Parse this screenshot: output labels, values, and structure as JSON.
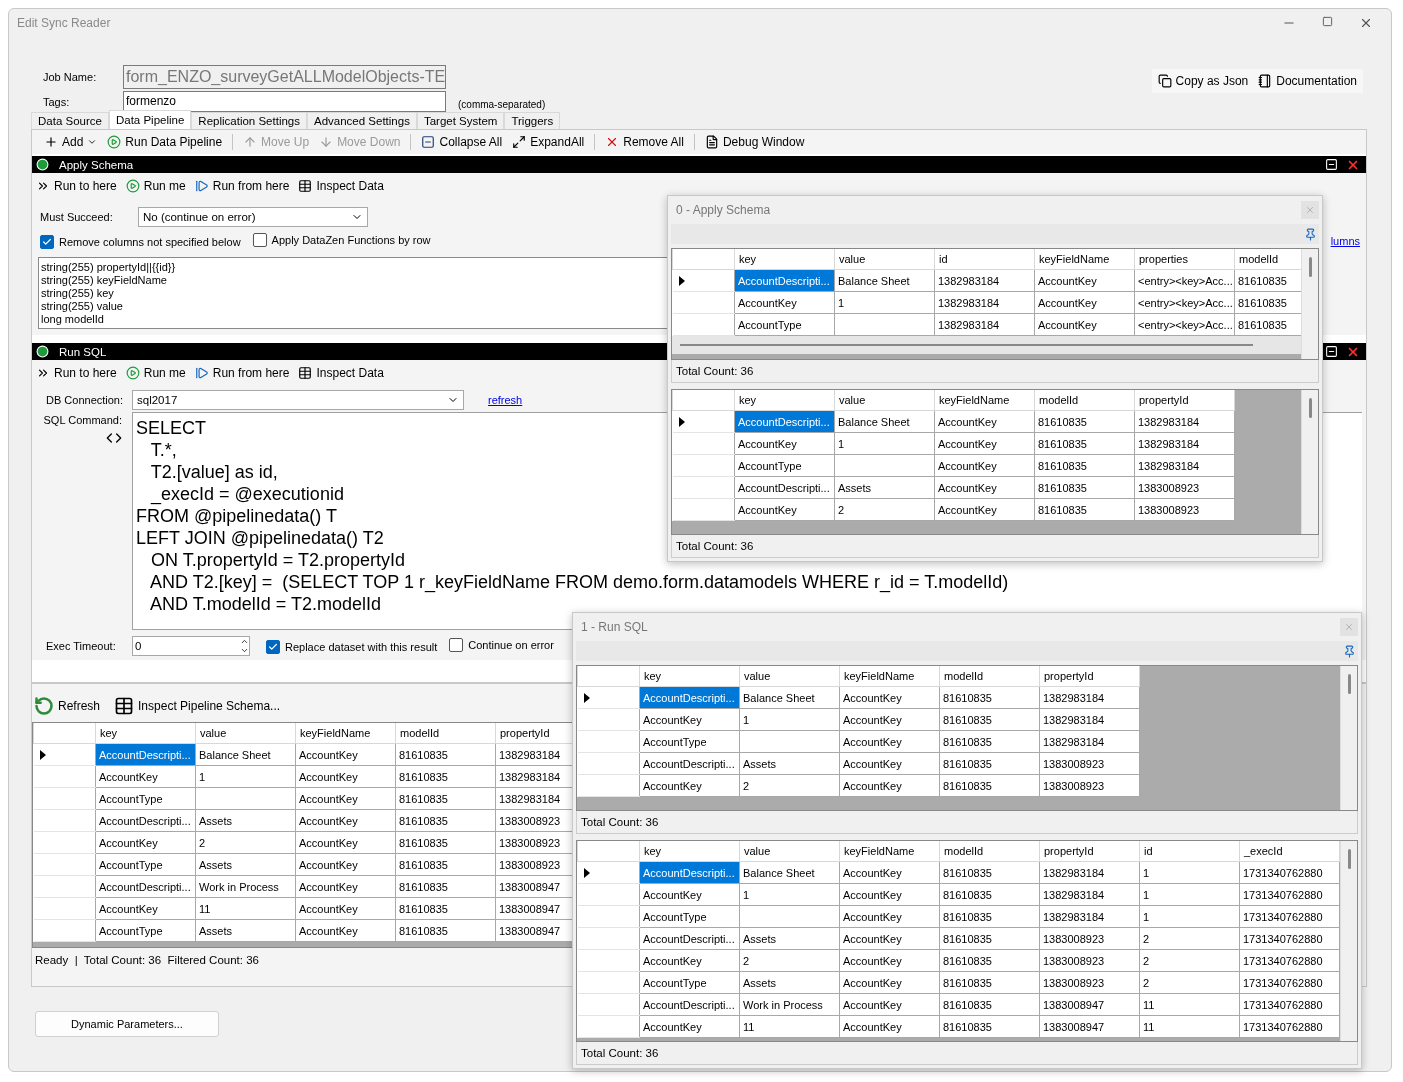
{
  "window": {
    "title": "Edit Sync Reader"
  },
  "job": {
    "name_label": "Job Name:",
    "name": "form_ENZO_surveyGetALLModelObjects-TE",
    "tags_label": "Tags:",
    "tags": "formenzo",
    "tags_hint": "(comma-separated)"
  },
  "header_actions": [
    {
      "kind": "copy",
      "label": "Copy as Json"
    },
    {
      "kind": "doc",
      "label": "Documentation"
    }
  ],
  "tabs": [
    {
      "label": "Data Source",
      "selected": false
    },
    {
      "label": "Data Pipeline",
      "selected": true
    },
    {
      "label": "Replication Settings",
      "selected": false
    },
    {
      "label": "Advanced Settings",
      "selected": false
    },
    {
      "label": "Target System",
      "selected": false
    },
    {
      "label": "Triggers",
      "selected": false
    }
  ],
  "toolbar": [
    {
      "kind": "add",
      "label": "Add",
      "disabled": false
    },
    {
      "kind": "run",
      "label": "Run Data Pipeline",
      "disabled": false
    },
    {
      "kind": "up",
      "label": "Move Up",
      "disabled": true
    },
    {
      "kind": "down",
      "label": "Move Down",
      "disabled": true
    },
    {
      "kind": "collapse",
      "label": "Collapse All",
      "disabled": false
    },
    {
      "kind": "expand",
      "label": "ExpandAll",
      "disabled": false
    },
    {
      "kind": "remove",
      "label": "Remove All",
      "disabled": false
    },
    {
      "kind": "debug",
      "label": "Debug Window",
      "disabled": false
    }
  ],
  "steps": [
    {
      "kind": "schema",
      "title": "Apply Schema",
      "actions": [
        {
          "kind": "runto",
          "label": "Run to here"
        },
        {
          "kind": "runme",
          "label": "Run me"
        },
        {
          "kind": "runfrom",
          "label": "Run from here"
        },
        {
          "kind": "inspect",
          "label": "Inspect Data"
        }
      ],
      "must_label": "Must Succeed:",
      "must_value": "No (continue on error)",
      "options": [
        {
          "label": "Remove columns not specified below",
          "checked": true
        },
        {
          "label": "Apply DataZen Functions by row",
          "checked": false
        }
      ],
      "link": "lumns",
      "schema": [
        "string(255) propertyId||{{id}}",
        "string(255) keyFieldName",
        "string(255) key",
        "string(255) value",
        "long modelId"
      ]
    },
    {
      "kind": "sql",
      "title": "Run SQL",
      "actions": [
        {
          "kind": "runto",
          "label": "Run to here"
        },
        {
          "kind": "runme",
          "label": "Run me"
        },
        {
          "kind": "runfrom",
          "label": "Run from here"
        },
        {
          "kind": "inspect",
          "label": "Inspect Data"
        }
      ],
      "db_label": "DB Connection:",
      "db_value": "sql2017",
      "refresh": "refresh",
      "sql_label": "SQL Command:",
      "sql": [
        "SELECT",
        "   T.*,",
        "   T2.[value] as id,",
        "   _execId = @executionid",
        "FROM @pipelinedata() T",
        "LEFT JOIN @pipelinedata() T2",
        "   ON T.propertyId = T2.propertyId",
        "   AND T2.[key] =  (SELECT TOP 1 r_keyFieldName FROM demo.form.datamodels WHERE r_id = T.modelId)",
        "   AND T.modelId = T2.modelId"
      ],
      "timeout_label": "Exec Timeout:",
      "timeout": "0",
      "options": [
        {
          "label": "Replace dataset with this result",
          "checked": true
        },
        {
          "label": "Continue on error",
          "checked": false
        }
      ]
    }
  ],
  "results": {
    "actions": [
      {
        "kind": "refresh",
        "label": "Refresh"
      },
      {
        "kind": "inspect",
        "label": "Inspect Pipeline Schema..."
      }
    ],
    "grid": {
      "columns": [
        "key",
        "value",
        "keyFieldName",
        "modelId",
        "propertyId"
      ],
      "rows": [
        {
          "selected": true,
          "cells": [
            "AccountDescripti...",
            "Balance Sheet",
            "AccountKey",
            "81610835",
            "1382983184"
          ]
        },
        {
          "selected": false,
          "cells": [
            "AccountKey",
            "1",
            "AccountKey",
            "81610835",
            "1382983184"
          ]
        },
        {
          "selected": false,
          "cells": [
            "AccountType",
            "",
            "AccountKey",
            "81610835",
            "1382983184"
          ]
        },
        {
          "selected": false,
          "cells": [
            "AccountDescripti...",
            "Assets",
            "AccountKey",
            "81610835",
            "1383008923"
          ]
        },
        {
          "selected": false,
          "cells": [
            "AccountKey",
            "2",
            "AccountKey",
            "81610835",
            "1383008923"
          ]
        },
        {
          "selected": false,
          "cells": [
            "AccountType",
            "Assets",
            "AccountKey",
            "81610835",
            "1383008923"
          ]
        },
        {
          "selected": false,
          "cells": [
            "AccountDescripti...",
            "Work in Process",
            "AccountKey",
            "81610835",
            "1383008947"
          ]
        },
        {
          "selected": false,
          "cells": [
            "AccountKey",
            "11",
            "AccountKey",
            "81610835",
            "1383008947"
          ]
        },
        {
          "selected": false,
          "cells": [
            "AccountType",
            "Assets",
            "AccountKey",
            "81610835",
            "1383008947"
          ]
        }
      ]
    },
    "status": "Ready  |  Total Count: 36  Filtered Count: 36"
  },
  "dynamic_button": "Dynamic Parameters...",
  "popups": [
    {
      "title": "0 - Apply Schema",
      "grids": [
        {
          "columns": [
            "key",
            "value",
            "id",
            "keyFieldName",
            "properties",
            "modelId"
          ],
          "total": "Total Count: 36",
          "rows": [
            {
              "selected": true,
              "cells": [
                "AccountDescripti...",
                "Balance Sheet",
                "1382983184",
                "AccountKey",
                "<entry><key>Acc...",
                "81610835"
              ]
            },
            {
              "selected": false,
              "cells": [
                "AccountKey",
                "1",
                "1382983184",
                "AccountKey",
                "<entry><key>Acc...",
                "81610835"
              ]
            },
            {
              "selected": false,
              "cells": [
                "AccountType",
                "",
                "1382983184",
                "AccountKey",
                "<entry><key>Acc...",
                "81610835"
              ]
            }
          ]
        },
        {
          "columns": [
            "key",
            "value",
            "keyFieldName",
            "modelId",
            "propertyId"
          ],
          "total": "Total Count: 36",
          "rows": [
            {
              "selected": true,
              "cells": [
                "AccountDescripti...",
                "Balance Sheet",
                "AccountKey",
                "81610835",
                "1382983184"
              ]
            },
            {
              "selected": false,
              "cells": [
                "AccountKey",
                "1",
                "AccountKey",
                "81610835",
                "1382983184"
              ]
            },
            {
              "selected": false,
              "cells": [
                "AccountType",
                "",
                "AccountKey",
                "81610835",
                "1382983184"
              ]
            },
            {
              "selected": false,
              "cells": [
                "AccountDescripti...",
                "Assets",
                "AccountKey",
                "81610835",
                "1383008923"
              ]
            },
            {
              "selected": false,
              "cells": [
                "AccountKey",
                "2",
                "AccountKey",
                "81610835",
                "1383008923"
              ]
            }
          ]
        }
      ]
    },
    {
      "title": "1 - Run SQL",
      "grids": [
        {
          "columns": [
            "key",
            "value",
            "keyFieldName",
            "modelId",
            "propertyId"
          ],
          "total": "Total Count: 36",
          "rows": [
            {
              "selected": true,
              "cells": [
                "AccountDescripti...",
                "Balance Sheet",
                "AccountKey",
                "81610835",
                "1382983184"
              ]
            },
            {
              "selected": false,
              "cells": [
                "AccountKey",
                "1",
                "AccountKey",
                "81610835",
                "1382983184"
              ]
            },
            {
              "selected": false,
              "cells": [
                "AccountType",
                "",
                "AccountKey",
                "81610835",
                "1382983184"
              ]
            },
            {
              "selected": false,
              "cells": [
                "AccountDescripti...",
                "Assets",
                "AccountKey",
                "81610835",
                "1383008923"
              ]
            },
            {
              "selected": false,
              "cells": [
                "AccountKey",
                "2",
                "AccountKey",
                "81610835",
                "1383008923"
              ]
            }
          ]
        },
        {
          "columns": [
            "key",
            "value",
            "keyFieldName",
            "modelId",
            "propertyId",
            "id",
            "_execId"
          ],
          "total": "Total Count: 36",
          "rows": [
            {
              "selected": true,
              "cells": [
                "AccountDescripti...",
                "Balance Sheet",
                "AccountKey",
                "81610835",
                "1382983184",
                "1",
                "1731340762880"
              ]
            },
            {
              "selected": false,
              "cells": [
                "AccountKey",
                "1",
                "AccountKey",
                "81610835",
                "1382983184",
                "1",
                "1731340762880"
              ]
            },
            {
              "selected": false,
              "cells": [
                "AccountType",
                "",
                "AccountKey",
                "81610835",
                "1382983184",
                "1",
                "1731340762880"
              ]
            },
            {
              "selected": false,
              "cells": [
                "AccountDescripti...",
                "Assets",
                "AccountKey",
                "81610835",
                "1383008923",
                "2",
                "1731340762880"
              ]
            },
            {
              "selected": false,
              "cells": [
                "AccountKey",
                "2",
                "AccountKey",
                "81610835",
                "1383008923",
                "2",
                "1731340762880"
              ]
            },
            {
              "selected": false,
              "cells": [
                "AccountType",
                "Assets",
                "AccountKey",
                "81610835",
                "1383008923",
                "2",
                "1731340762880"
              ]
            },
            {
              "selected": false,
              "cells": [
                "AccountDescripti...",
                "Work in Process",
                "AccountKey",
                "81610835",
                "1383008947",
                "11",
                "1731340762880"
              ]
            },
            {
              "selected": false,
              "cells": [
                "AccountKey",
                "11",
                "AccountKey",
                "81610835",
                "1383008947",
                "11",
                "1731340762880"
              ]
            }
          ]
        }
      ]
    }
  ]
}
